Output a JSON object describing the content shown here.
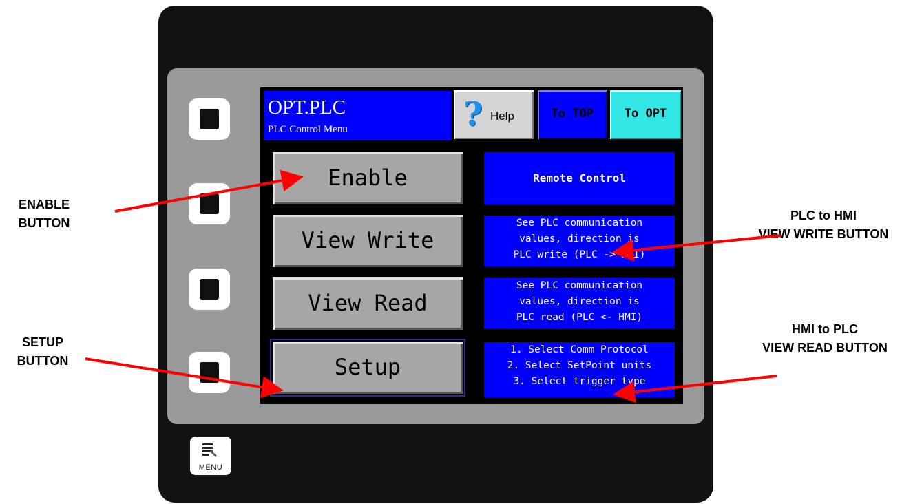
{
  "screen": {
    "title": "OPT.PLC",
    "subtitle": "PLC Control Menu",
    "help_label": "Help",
    "nav_top_label": "To TOP",
    "nav_opt_label": "To OPT"
  },
  "menu": {
    "enable": "Enable",
    "view_write": "View Write",
    "view_read": "View Read",
    "setup": "Setup"
  },
  "info": {
    "remote": "Remote Control",
    "view_write": [
      "See PLC communication",
      "values, direction is",
      "PLC write (PLC -> HMI)"
    ],
    "view_read": [
      "See PLC communication",
      "values, direction is",
      "PLC read (PLC <- HMI)"
    ],
    "setup": [
      "1. Select Comm Protocol",
      "2. Select SetPoint units",
      "3. Select trigger type"
    ]
  },
  "device": {
    "menu_key_label": "MENU"
  },
  "callouts": {
    "enable": [
      "ENABLE",
      "BUTTON"
    ],
    "setup": [
      "SETUP",
      "BUTTON"
    ],
    "view_write": [
      "PLC to HMI",
      "VIEW WRITE BUTTON"
    ],
    "view_read": [
      "HMI to PLC",
      "VIEW READ BUTTON"
    ]
  },
  "colors": {
    "panel_blue": "#0000ff",
    "opt_cyan": "#33e6e6",
    "button_gray": "#a6a6a6",
    "arrow_red": "#ff0000"
  },
  "icons": {
    "help": "question-mark-icon",
    "menu": "menu-icon"
  }
}
